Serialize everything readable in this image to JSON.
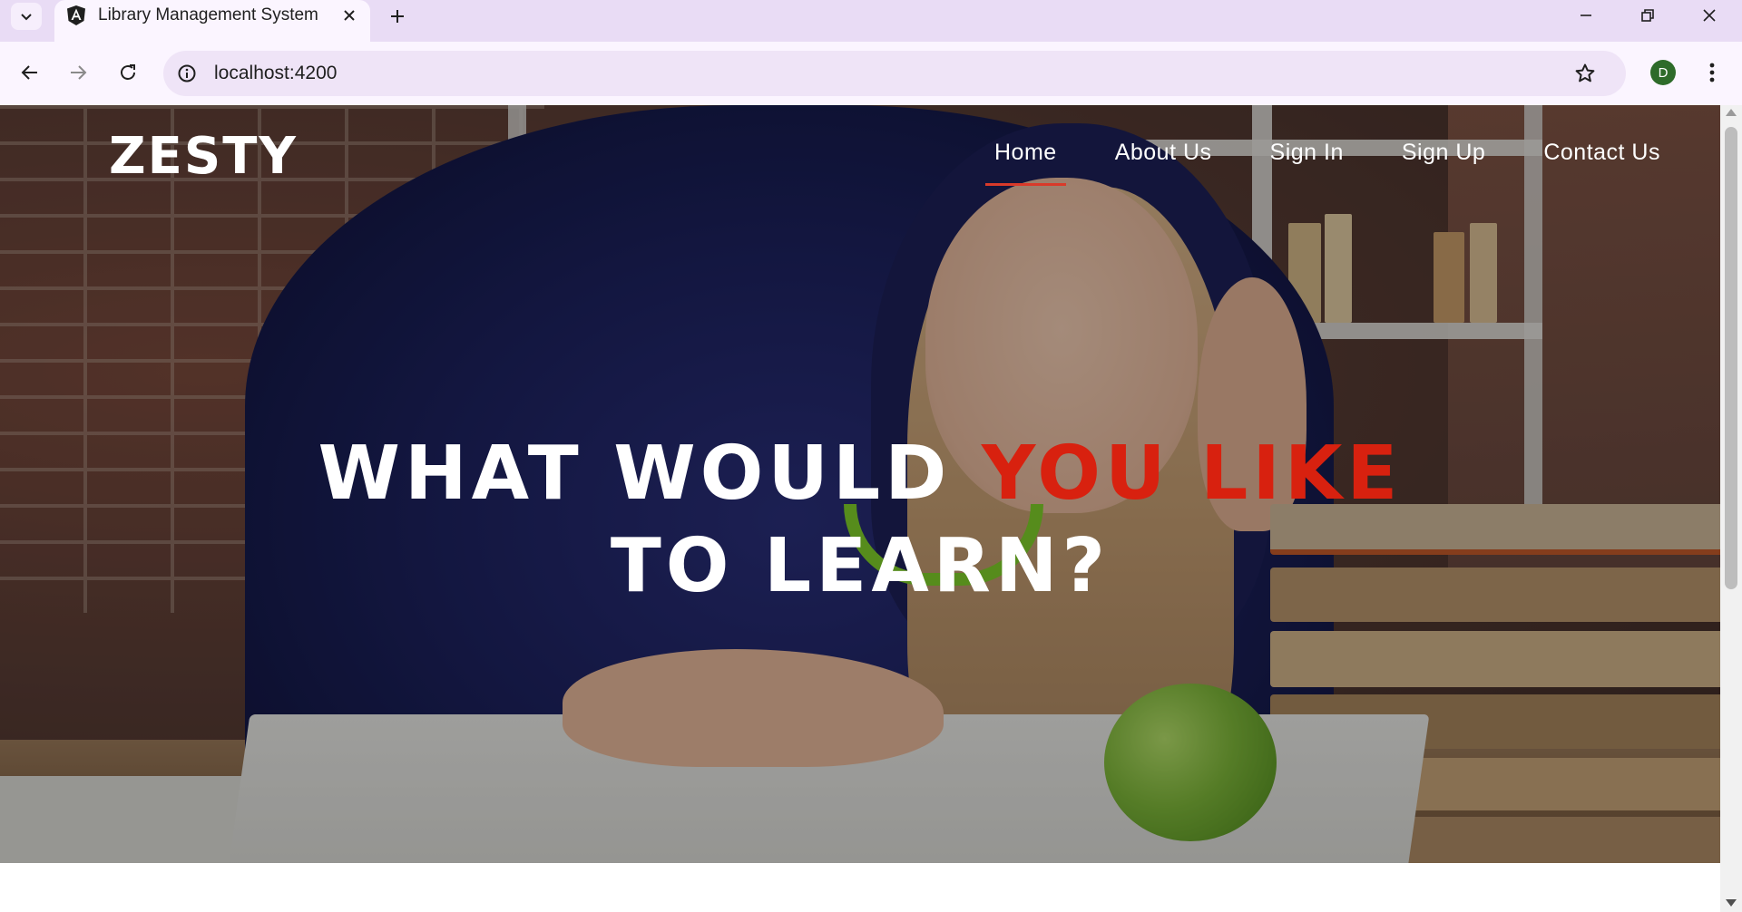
{
  "browser": {
    "tab": {
      "title": "Library Management System",
      "favicon": "angular-icon"
    },
    "address_bar": {
      "url": "localhost:4200"
    },
    "profile": {
      "initial": "D",
      "color": "#2e6b2a"
    },
    "icons": {
      "tab_search": "chevron-down-icon",
      "close_tab": "close-icon",
      "new_tab": "plus-icon",
      "minimize": "minimize-icon",
      "restore": "restore-icon",
      "close_window": "close-icon",
      "back": "arrow-left-icon",
      "forward": "arrow-right-icon",
      "reload": "reload-icon",
      "site_info": "info-icon",
      "bookmark": "star-icon",
      "menu": "kebab-menu-icon"
    }
  },
  "site": {
    "brand": "ZESTY",
    "nav": [
      {
        "label": "Home",
        "active": true
      },
      {
        "label": "About Us",
        "active": false
      },
      {
        "label": "Sign In",
        "active": false
      },
      {
        "label": "Sign Up",
        "active": false
      },
      {
        "label": "Contact Us",
        "active": false
      }
    ],
    "hero": {
      "headline_part1": "WHAT WOULD ",
      "headline_accent": "YOU LIKE",
      "headline_part2": "TO LEARN?"
    },
    "colors": {
      "accent": "#d8210f",
      "active_underline": "#d93a2a",
      "text": "#ffffff"
    }
  }
}
